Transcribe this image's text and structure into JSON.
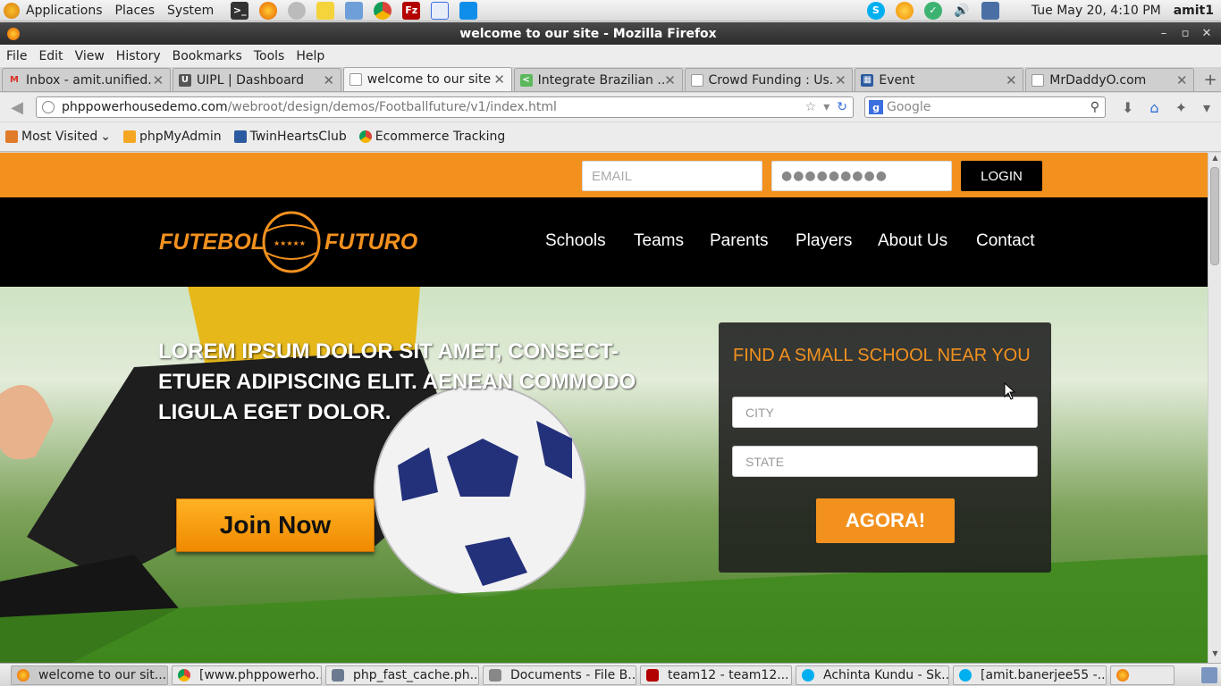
{
  "panel": {
    "menus": [
      "Applications",
      "Places",
      "System"
    ],
    "clock": "Tue May 20,  4:10 PM",
    "user": "amit1"
  },
  "window": {
    "title": "welcome to our site - Mozilla Firefox"
  },
  "menubar": [
    "File",
    "Edit",
    "View",
    "History",
    "Bookmarks",
    "Tools",
    "Help"
  ],
  "tabs": [
    {
      "label": "Inbox - amit.unified...",
      "icon": "gmail-icon",
      "color": "#d93025"
    },
    {
      "label": "UIPL | Dashboard",
      "icon": "uipl-icon",
      "color": "#555555"
    },
    {
      "label": "welcome to our site",
      "icon": "blank-page-icon",
      "color": "#ffffff"
    },
    {
      "label": "Integrate Brazilian ...",
      "icon": "site-icon",
      "color": "#5cb85c"
    },
    {
      "label": "Crowd Funding : Us...",
      "icon": "blank-page-icon",
      "color": "#ffffff"
    },
    {
      "label": "Event",
      "icon": "grid-icon",
      "color": "#2c5aa0"
    },
    {
      "label": "MrDaddyO.com",
      "icon": "blank-page-icon",
      "color": "#ffffff"
    }
  ],
  "urlbar": {
    "host": "phppowerhousedemo.com",
    "path": "/webroot/design/demos/Footballfuture/v1/index.html"
  },
  "searchbar": {
    "placeholder": "Google"
  },
  "bookmarks": [
    "Most Visited",
    "phpMyAdmin",
    "TwinHeartsClub",
    "Ecommerce Tracking"
  ],
  "site": {
    "login": {
      "email_placeholder": "EMAIL",
      "password_mask": "●●●●●●●●●",
      "login_label": "LOGIN"
    },
    "logo": {
      "left": "FUTEBOL",
      "right": "FUTURO",
      "stars": "★★★★★"
    },
    "nav": [
      "Schools",
      "Teams",
      "Parents",
      "Players",
      "About Us",
      "Contact"
    ],
    "hero": {
      "headline_lines": [
        "LOREM IPSUM DOLOR SIT AMET, CONSECT-",
        "ETUER ADIPISCING ELIT. AENEAN COMMODO",
        "LIGULA EGET DOLOR."
      ],
      "join_label": "Join Now"
    },
    "finder": {
      "title": "FIND A SMALL SCHOOL NEAR YOU",
      "city_placeholder": "CITY",
      "state_placeholder": "STATE",
      "submit_label": "AGORA!"
    },
    "colors": {
      "accent": "#f3911f",
      "header": "#000000"
    }
  },
  "taskbar": [
    {
      "label": "welcome to our sit...",
      "color": "#e66000"
    },
    {
      "label": "[www.phppowerho...",
      "color": "#4a8af4"
    },
    {
      "label": "php_fast_cache.ph...",
      "color": "#6b7a8f"
    },
    {
      "label": "Documents - File B...",
      "color": "#888888"
    },
    {
      "label": "team12 - team12...",
      "color": "#c1272d"
    },
    {
      "label": "Achinta Kundu - Sk...",
      "color": "#00aff0"
    },
    {
      "label": "[amit.banerjee55 -...",
      "color": "#00aff0"
    }
  ]
}
